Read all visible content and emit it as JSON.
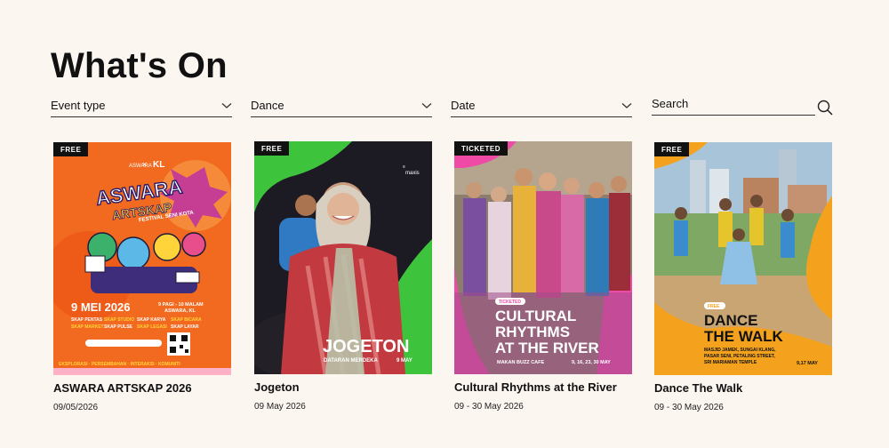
{
  "page": {
    "title": "What's On"
  },
  "filters": [
    {
      "label": "Event type"
    },
    {
      "label": "Dance"
    },
    {
      "label": "Date"
    }
  ],
  "search": {
    "placeholder": "Search"
  },
  "colors": {
    "background": "#fcf6f1",
    "badge": "#111111"
  },
  "events": [
    {
      "badge": "FREE",
      "title": "ASWARA ARTSKAP 2026",
      "date": "09/05/2026",
      "poster": {
        "theme": "orange",
        "brand_a": "ASWARA",
        "brand_b": "KL",
        "headline_1": "ASWARA",
        "headline_2": "ARTSKAP",
        "tagline": "FESTIVAL SENI KOTA",
        "big_date": "9 MEI 2026",
        "time": "9 PAGI - 10 MALAM",
        "venue": "ASWARA, KL",
        "skap_1": "SKAP PENTAS",
        "skap_2": "SKAP STUDIO",
        "skap_3": "SKAP KARYA",
        "skap_4": "SKAP BICARA",
        "skap_5": "SKAP MARKET",
        "skap_6": "SKAP PULSE",
        "skap_7": "SKAP LEGASI",
        "skap_8": "SKAP LAYAR",
        "footer": "EKSPLORASI · PERSEMBAHAN · INTERAKSI · KOMUNITI"
      }
    },
    {
      "badge": "FREE",
      "title": "Jogeton",
      "date": "09 May 2026",
      "poster": {
        "theme": "green",
        "headline": "JOGETON",
        "venue": "DATARAN MERDEKA",
        "day": "9 MAY",
        "sponsor": "maxis"
      }
    },
    {
      "badge": "TICKETED",
      "title": "Cultural Rhythms at the River",
      "date": "09 - 30 May 2026",
      "poster": {
        "theme": "pink",
        "tag": "TICKETED",
        "headline_1": "CULTURAL",
        "headline_2": "RHYTHMS",
        "headline_3": "AT THE RIVER",
        "venue": "MAKAN BUZZ CAFE",
        "days": "9, 16, 23, 30 MAY"
      }
    },
    {
      "badge": "FREE",
      "title": "Dance The Walk",
      "date": "09 - 30 May 2026",
      "poster": {
        "theme": "amber",
        "tag": "FREE",
        "headline_1": "DANCE",
        "headline_2": "THE WALK",
        "venue_1": "MASJID JAMEK, SUNGAI KLANG,",
        "venue_2": "PASAR SENI, PETALING STREET,",
        "venue_3": "SRI MARIAMAN TEMPLE",
        "days": "9,17 MAY"
      }
    }
  ]
}
